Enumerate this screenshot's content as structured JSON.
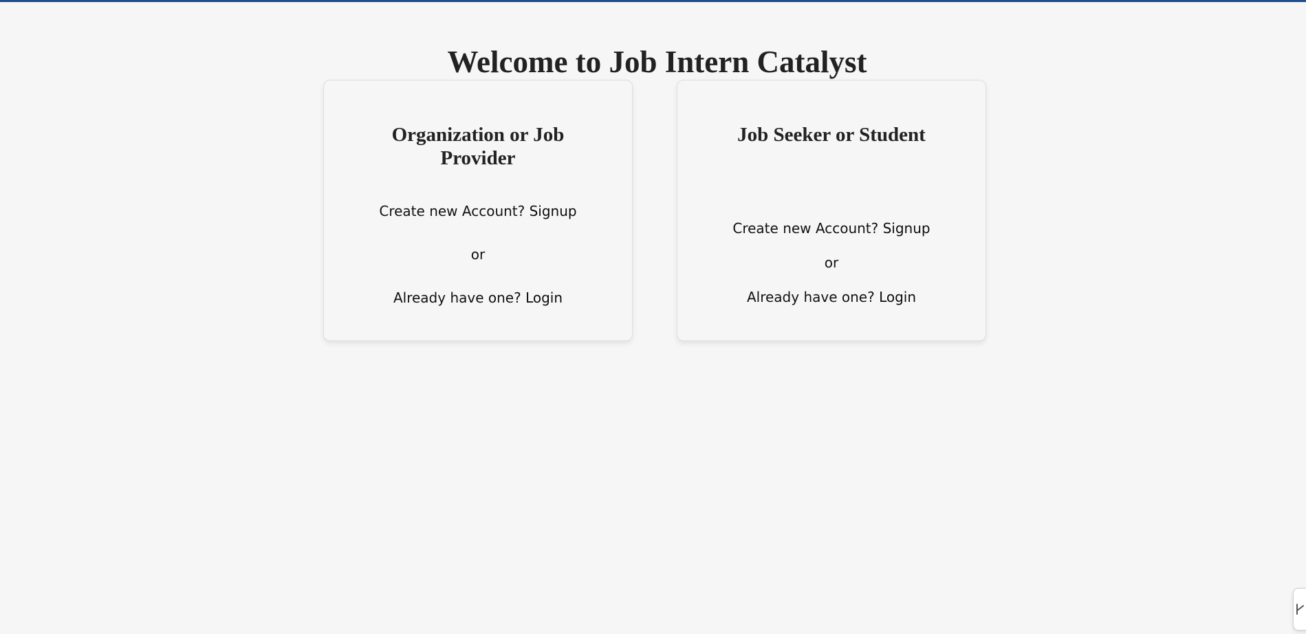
{
  "colors": {
    "background": "#f6f6f6",
    "top_bar": "#1d4f8c",
    "text": "#222222",
    "card_border": "#dedede"
  },
  "page": {
    "title": "Welcome to Job Intern Catalyst"
  },
  "cards": [
    {
      "heading": "Organization or Job Provider",
      "signup_prompt": "Create new Account?",
      "signup_link": "Signup",
      "separator": "or",
      "login_prompt": "Already have one?",
      "login_link": "Login"
    },
    {
      "heading": "Job Seeker or Student",
      "signup_prompt": "Create new Account?",
      "signup_link": "Signup",
      "separator": "or",
      "login_prompt": "Already have one?",
      "login_link": "Login"
    }
  ],
  "widget": {
    "icon": "edge-widget-icon"
  }
}
